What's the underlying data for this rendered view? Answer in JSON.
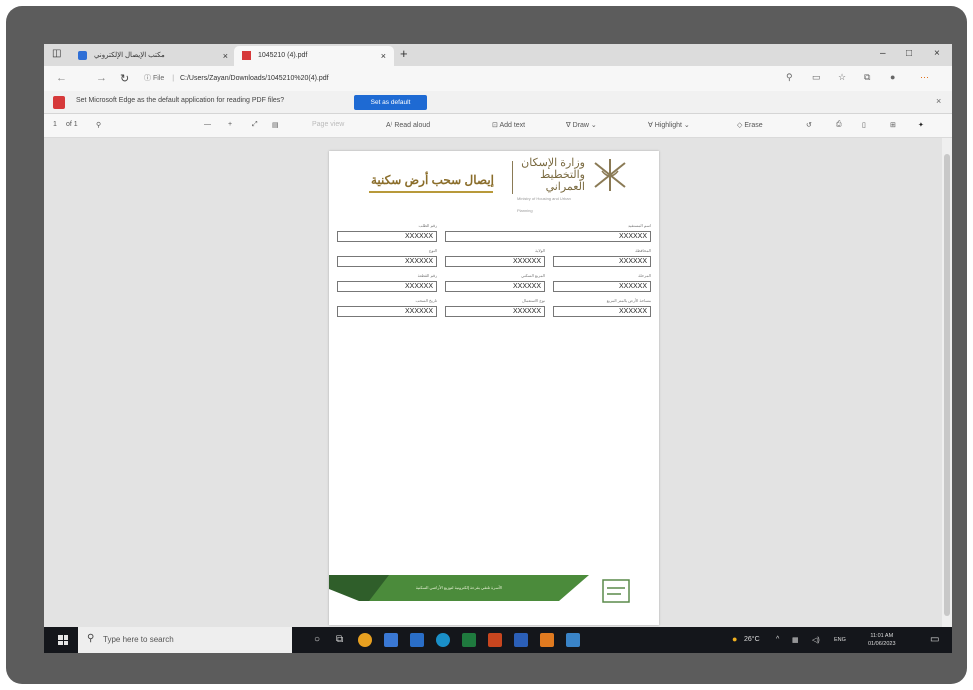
{
  "browser": {
    "tabs": [
      {
        "label": "مكتب الإيصال الإلكتروني"
      },
      {
        "label": "1045210 (4).pdf"
      }
    ],
    "new_tab_glyph": "+",
    "close_glyph": "×",
    "url_prefix": "File",
    "url": "C:/Users/Zayan/Downloads/1045210%20(4).pdf",
    "window_controls": [
      "–",
      "□",
      "×"
    ]
  },
  "infobar": {
    "message": "Set Microsoft Edge as the default application for reading PDF files?",
    "button_label": "Set as default"
  },
  "pdf_toolbar": {
    "page_number": "1",
    "page_total": "of 1",
    "zoom_minus": "—",
    "zoom_plus": "+",
    "page_view": "Page view",
    "read_aloud": "Read aloud",
    "add_text": "Add text",
    "draw": "Draw",
    "highlight": "Highlight",
    "erase": "Erase"
  },
  "document": {
    "ministry_name": "وزارة الإسكان والتخطيط العمراني",
    "ministry_name_en": "Ministry of Housing and Urban Planning",
    "title": "إيصال سحب أرض سكنية",
    "fields": [
      {
        "label": "رقم الطلب",
        "value": "XXXXXX"
      },
      {
        "label": "اسم المستفيد",
        "value": "XXXXXX"
      },
      {
        "label": "النوع",
        "value": "XXXXXX"
      },
      {
        "label": "الولاية",
        "value": "XXXXXX"
      },
      {
        "label": "المحافظة",
        "value": "XXXXXX"
      },
      {
        "label": "رقم القطعة",
        "value": "XXXXXX"
      },
      {
        "label": "المربع السكني",
        "value": "XXXXXX"
      },
      {
        "label": "المرحلة",
        "value": "XXXXXX"
      },
      {
        "label": "تاريخ السحب",
        "value": "XXXXXX"
      },
      {
        "label": "نوع الاستعمال",
        "value": "XXXXXX"
      },
      {
        "label": "مساحة الأرض بالمتر المربع",
        "value": "XXXXXX"
      }
    ],
    "footer_text": "الأسرة تلتقي بقرعة إلكترونية لتوزيع الأراضي السكنية"
  },
  "taskbar": {
    "search_placeholder": "Type here to search",
    "weather": "26°C",
    "lang": "ENG",
    "time": "11:01 AM",
    "date": "01/06/2023"
  },
  "colors": {
    "accent_blue": "#1e6ad3",
    "pdf_red": "#d6393a",
    "title_gold": "#8a6d2a",
    "banner_green": "#4b8b3b"
  }
}
